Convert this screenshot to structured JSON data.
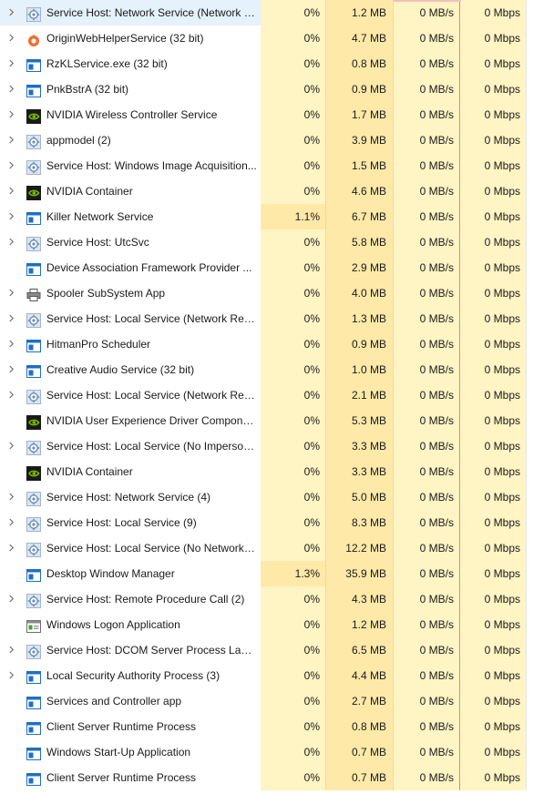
{
  "processes": [
    {
      "name": "Service Host: Network Service (Network R...",
      "icon": "gear-icon",
      "expand": true,
      "cpu": "0%",
      "memory": "1.2 MB",
      "disk": "0 MB/s",
      "network": "0 Mbps"
    },
    {
      "name": "OriginWebHelperService (32 bit)",
      "icon": "origin-icon",
      "expand": true,
      "cpu": "0%",
      "memory": "4.7 MB",
      "disk": "0 MB/s",
      "network": "0 Mbps"
    },
    {
      "name": "RzKLService.exe (32 bit)",
      "icon": "window-app-icon",
      "expand": true,
      "cpu": "0%",
      "memory": "0.8 MB",
      "disk": "0 MB/s",
      "network": "0 Mbps"
    },
    {
      "name": "PnkBstrA (32 bit)",
      "icon": "window-app-icon",
      "expand": true,
      "cpu": "0%",
      "memory": "0.9 MB",
      "disk": "0 MB/s",
      "network": "0 Mbps"
    },
    {
      "name": "NVIDIA Wireless Controller Service",
      "icon": "nvidia-icon",
      "expand": true,
      "cpu": "0%",
      "memory": "1.7 MB",
      "disk": "0 MB/s",
      "network": "0 Mbps"
    },
    {
      "name": "appmodel (2)",
      "icon": "gear-icon",
      "expand": true,
      "cpu": "0%",
      "memory": "3.9 MB",
      "disk": "0 MB/s",
      "network": "0 Mbps"
    },
    {
      "name": "Service Host: Windows Image Acquisition...",
      "icon": "gear-icon",
      "expand": true,
      "cpu": "0%",
      "memory": "1.5 MB",
      "disk": "0 MB/s",
      "network": "0 Mbps"
    },
    {
      "name": "NVIDIA Container",
      "icon": "nvidia-icon",
      "expand": true,
      "cpu": "0%",
      "memory": "4.6 MB",
      "disk": "0 MB/s",
      "network": "0 Mbps"
    },
    {
      "name": "Killer Network Service",
      "icon": "window-app-icon",
      "expand": true,
      "cpu": "1.1%",
      "cpu_high": true,
      "memory": "6.7 MB",
      "disk": "0 MB/s",
      "network": "0 Mbps"
    },
    {
      "name": "Service Host: UtcSvc",
      "icon": "gear-icon",
      "expand": true,
      "cpu": "0%",
      "memory": "5.8 MB",
      "disk": "0 MB/s",
      "network": "0 Mbps"
    },
    {
      "name": "Device Association Framework Provider ...",
      "icon": "window-app-icon",
      "expand": false,
      "cpu": "0%",
      "memory": "2.9 MB",
      "disk": "0 MB/s",
      "network": "0 Mbps"
    },
    {
      "name": "Spooler SubSystem App",
      "icon": "printer-icon",
      "expand": true,
      "cpu": "0%",
      "memory": "4.0 MB",
      "disk": "0 MB/s",
      "network": "0 Mbps"
    },
    {
      "name": "Service Host: Local Service (Network Rest...",
      "icon": "gear-icon",
      "expand": true,
      "cpu": "0%",
      "memory": "1.3 MB",
      "disk": "0 MB/s",
      "network": "0 Mbps"
    },
    {
      "name": "HitmanPro Scheduler",
      "icon": "window-app-icon",
      "expand": true,
      "cpu": "0%",
      "memory": "0.9 MB",
      "disk": "0 MB/s",
      "network": "0 Mbps"
    },
    {
      "name": "Creative Audio Service (32 bit)",
      "icon": "window-app-icon",
      "expand": true,
      "cpu": "0%",
      "memory": "1.0 MB",
      "disk": "0 MB/s",
      "network": "0 Mbps"
    },
    {
      "name": "Service Host: Local Service (Network Rest...",
      "icon": "gear-icon",
      "expand": true,
      "cpu": "0%",
      "memory": "2.1 MB",
      "disk": "0 MB/s",
      "network": "0 Mbps"
    },
    {
      "name": "NVIDIA User Experience Driver Component",
      "icon": "nvidia-icon",
      "expand": false,
      "cpu": "0%",
      "memory": "5.3 MB",
      "disk": "0 MB/s",
      "network": "0 Mbps"
    },
    {
      "name": "Service Host: Local Service (No Imperson...",
      "icon": "gear-icon",
      "expand": true,
      "cpu": "0%",
      "memory": "3.3 MB",
      "disk": "0 MB/s",
      "network": "0 Mbps"
    },
    {
      "name": "NVIDIA Container",
      "icon": "nvidia-icon",
      "expand": false,
      "cpu": "0%",
      "memory": "3.3 MB",
      "disk": "0 MB/s",
      "network": "0 Mbps"
    },
    {
      "name": "Service Host: Network Service (4)",
      "icon": "gear-icon",
      "expand": true,
      "cpu": "0%",
      "memory": "5.0 MB",
      "disk": "0 MB/s",
      "network": "0 Mbps"
    },
    {
      "name": "Service Host: Local Service (9)",
      "icon": "gear-icon",
      "expand": true,
      "cpu": "0%",
      "memory": "8.3 MB",
      "disk": "0 MB/s",
      "network": "0 Mbps"
    },
    {
      "name": "Service Host: Local Service (No Network) ...",
      "icon": "gear-icon",
      "expand": true,
      "cpu": "0%",
      "memory": "12.2 MB",
      "disk": "0 MB/s",
      "network": "0 Mbps"
    },
    {
      "name": "Desktop Window Manager",
      "icon": "window-app-icon",
      "expand": false,
      "cpu": "1.3%",
      "cpu_high": true,
      "memory": "35.9 MB",
      "disk": "0 MB/s",
      "network": "0 Mbps"
    },
    {
      "name": "Service Host: Remote Procedure Call (2)",
      "icon": "gear-icon",
      "expand": true,
      "cpu": "0%",
      "memory": "4.3 MB",
      "disk": "0 MB/s",
      "network": "0 Mbps"
    },
    {
      "name": "Windows Logon Application",
      "icon": "logon-app-icon",
      "expand": false,
      "cpu": "0%",
      "memory": "1.2 MB",
      "disk": "0 MB/s",
      "network": "0 Mbps"
    },
    {
      "name": "Service Host: DCOM Server Process Laun...",
      "icon": "gear-icon",
      "expand": true,
      "cpu": "0%",
      "memory": "6.5 MB",
      "disk": "0 MB/s",
      "network": "0 Mbps"
    },
    {
      "name": "Local Security Authority Process (3)",
      "icon": "window-app-icon",
      "expand": true,
      "cpu": "0%",
      "memory": "4.4 MB",
      "disk": "0 MB/s",
      "network": "0 Mbps"
    },
    {
      "name": "Services and Controller app",
      "icon": "window-app-icon",
      "expand": false,
      "cpu": "0%",
      "memory": "2.7 MB",
      "disk": "0 MB/s",
      "network": "0 Mbps"
    },
    {
      "name": "Client Server Runtime Process",
      "icon": "window-app-icon",
      "expand": false,
      "cpu": "0%",
      "memory": "0.8 MB",
      "disk": "0 MB/s",
      "network": "0 Mbps"
    },
    {
      "name": "Windows Start-Up Application",
      "icon": "window-app-icon",
      "expand": false,
      "cpu": "0%",
      "memory": "0.7 MB",
      "disk": "0 MB/s",
      "network": "0 Mbps"
    },
    {
      "name": "Client Server Runtime Process",
      "icon": "window-app-icon",
      "expand": false,
      "cpu": "0%",
      "memory": "0.7 MB",
      "disk": "0 MB/s",
      "network": "0 Mbps"
    }
  ],
  "colors": {
    "cpu_bg": "#fff4c4",
    "cpu_bg_high": "#ffe9a8",
    "memory_bg": "#ffe9a8",
    "disk_border": "#e08a80",
    "nvidia_green": "#76b900",
    "origin_orange": "#f56c2d",
    "app_blue": "#1e6fc4"
  },
  "icons": {
    "expand": "chevron-right-icon"
  }
}
